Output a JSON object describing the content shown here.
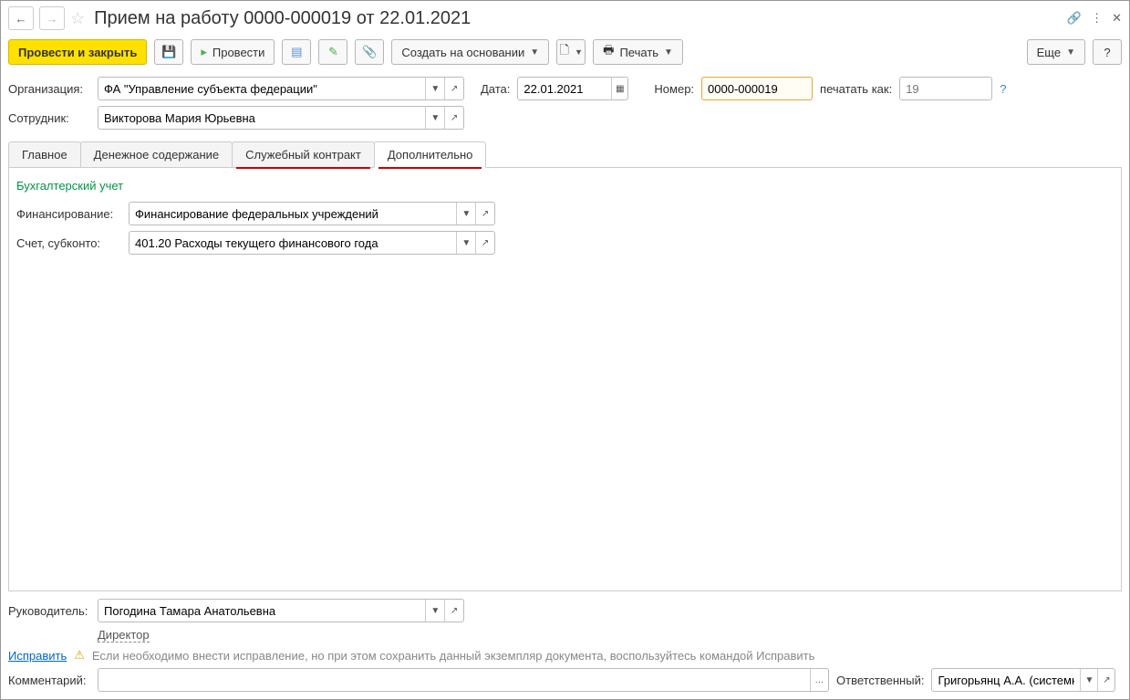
{
  "title": "Прием на работу 0000-000019 от 22.01.2021",
  "toolbar": {
    "post_close": "Провести и закрыть",
    "post": "Провести",
    "create_based": "Создать на основании",
    "print": "Печать",
    "more": "Еще"
  },
  "fields": {
    "org_label": "Организация:",
    "org_value": "ФА \"Управление субъекта федерации\"",
    "date_label": "Дата:",
    "date_value": "22.01.2021",
    "number_label": "Номер:",
    "number_value": "0000-000019",
    "print_as_label": "печатать как:",
    "print_as_value": "19",
    "employee_label": "Сотрудник:",
    "employee_value": "Викторова Мария Юрьевна"
  },
  "tabs": [
    "Главное",
    "Денежное содержание",
    "Служебный контракт",
    "Дополнительно"
  ],
  "tab_content": {
    "section": "Бухгалтерский учет",
    "financing_label": "Финансирование:",
    "financing_value": "Финансирование федеральных учреждений",
    "account_label": "Счет, субконто:",
    "account_value": "401.20 Расходы текущего финансового года"
  },
  "footer": {
    "manager_label": "Руководитель:",
    "manager_value": "Погодина Тамара Анатольевна",
    "manager_position": "Директор",
    "correct_link": "Исправить",
    "correct_text": "Если необходимо внести исправление, но при этом сохранить данный экземпляр документа, воспользуйтесь командой Исправить",
    "comment_label": "Комментарий:",
    "responsible_label": "Ответственный:",
    "responsible_value": "Григорьянц А.А. (системн"
  },
  "help": "?"
}
